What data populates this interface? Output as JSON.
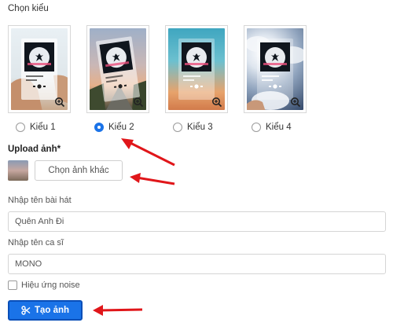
{
  "section_title": "Chọn kiểu",
  "styles": [
    {
      "label": "Kiểu 1",
      "selected": false,
      "background": "hand-holding-card",
      "zoom_icon": "zoom-in-icon"
    },
    {
      "label": "Kiểu 2",
      "selected": true,
      "background": "sunset-street",
      "zoom_icon": "zoom-in-icon"
    },
    {
      "label": "Kiểu 3",
      "selected": false,
      "background": "sunset-sky",
      "zoom_icon": "zoom-in-icon"
    },
    {
      "label": "Kiểu 4",
      "selected": false,
      "background": "cloudy-sky",
      "zoom_icon": "zoom-in-icon"
    }
  ],
  "upload": {
    "label": "Upload ảnh*",
    "choose_button": "Chọn ảnh khác"
  },
  "song_name": {
    "label": "Nhập tên bài hát",
    "value": "Quên Anh Đi"
  },
  "singer_name": {
    "label": "Nhập tên ca sĩ",
    "value": "MONO"
  },
  "noise": {
    "label": "Hiệu ứng noise",
    "checked": false
  },
  "submit": {
    "label": "Tạo ảnh",
    "icon": "scissors-icon"
  },
  "colors": {
    "primary": "#1a73e8",
    "annotation_arrow": "#e0161a"
  }
}
